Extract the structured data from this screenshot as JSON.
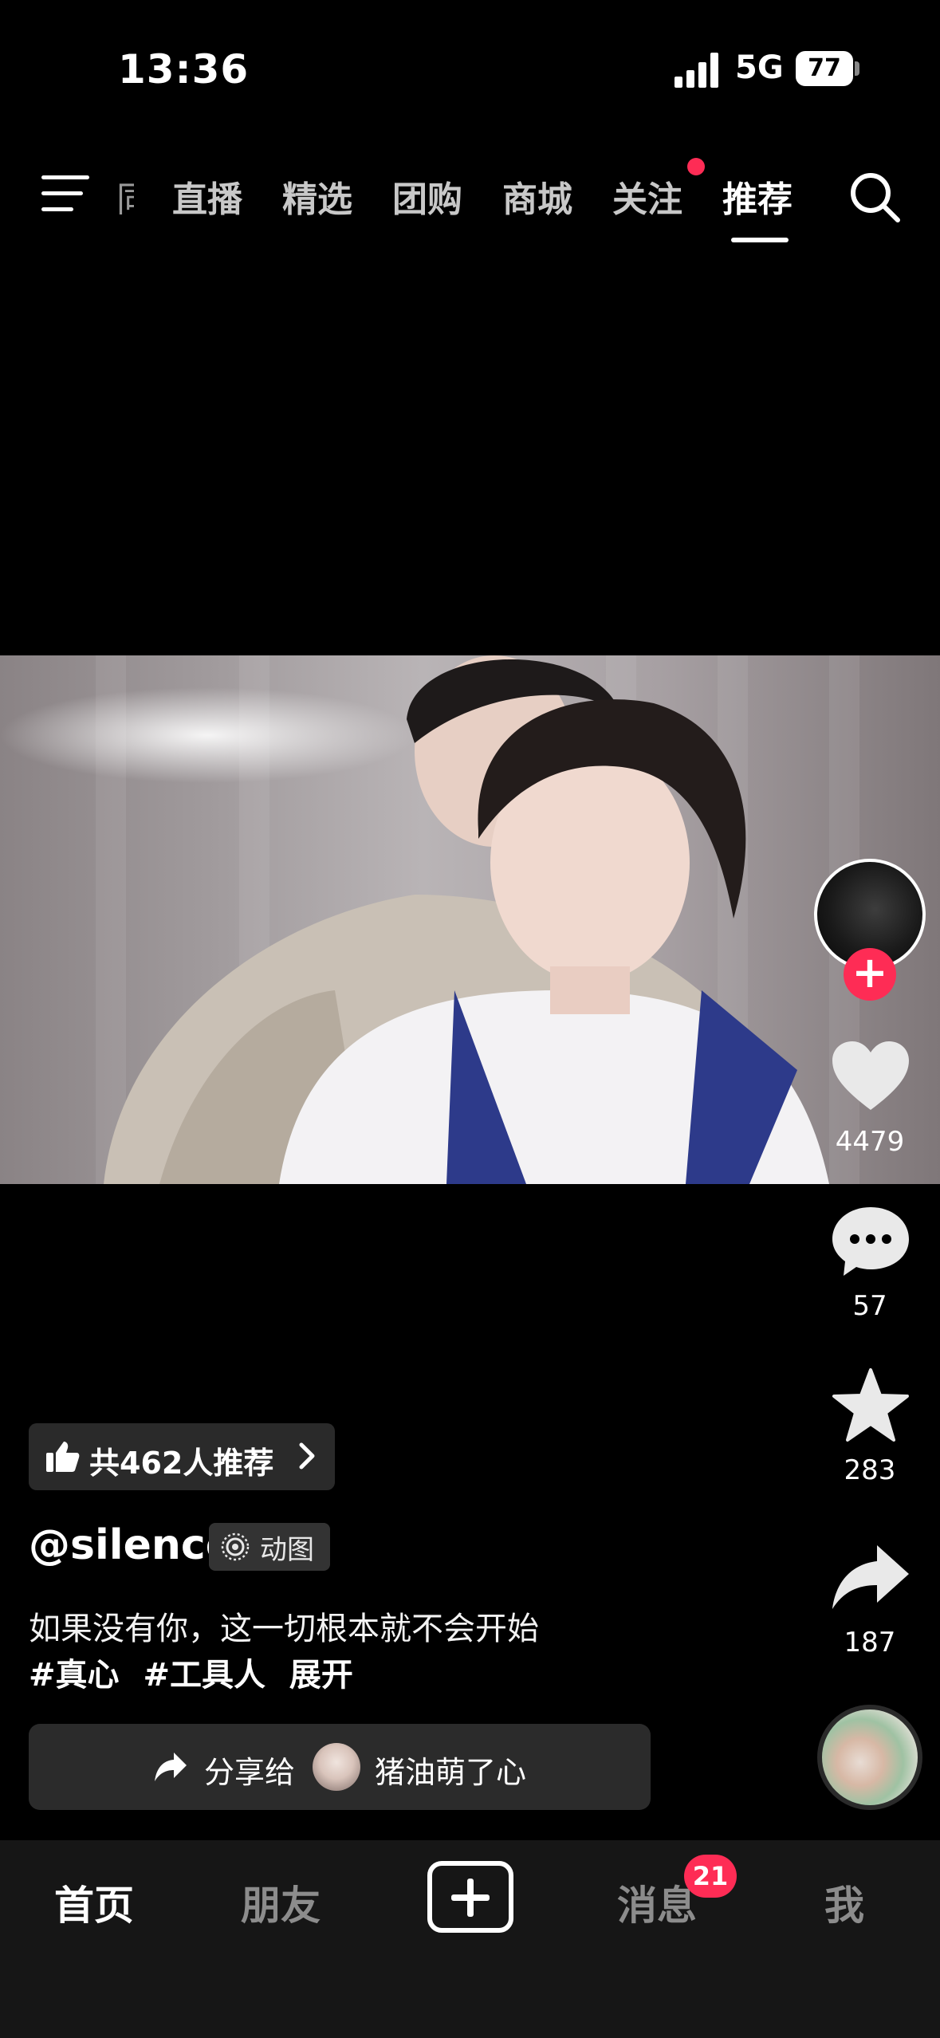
{
  "status_bar": {
    "time": "13:36",
    "network": "5G",
    "battery": "77"
  },
  "top_tabs": {
    "partial": "同城",
    "items": [
      "直播",
      "精选",
      "团购",
      "商城",
      "关注"
    ],
    "active": "推荐"
  },
  "rail": {
    "likes": "4479",
    "comments": "57",
    "favorites": "283",
    "shares": "187"
  },
  "recommend": {
    "text": "共462人推荐"
  },
  "post": {
    "username": "@silence",
    "badge": "动图",
    "caption": "如果没有你，这一切根本就不会开始",
    "hashtags": [
      "#真心",
      "#工具人"
    ],
    "expand": "展开"
  },
  "share": {
    "label": "分享给",
    "friend": "猪油萌了心"
  },
  "bottom_nav": {
    "home": "首页",
    "friends": "朋友",
    "messages": "消息",
    "messages_badge": "21",
    "me": "我"
  },
  "colors": {
    "accent": "#fe2c55",
    "background": "#000000",
    "nav_bg": "#161616"
  }
}
